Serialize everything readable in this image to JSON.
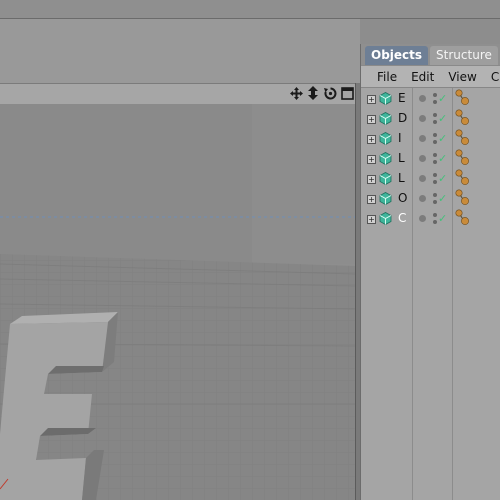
{
  "panel": {
    "tabs": [
      {
        "label": "Objects",
        "active": true
      },
      {
        "label": "Structure",
        "active": false
      }
    ],
    "menu": [
      "File",
      "Edit",
      "View",
      "C"
    ]
  },
  "objects": [
    {
      "name": "E",
      "selected": false
    },
    {
      "name": "D",
      "selected": false
    },
    {
      "name": "I",
      "selected": false
    },
    {
      "name": "L",
      "selected": false
    },
    {
      "name": "L",
      "selected": false
    },
    {
      "name": "O",
      "selected": false
    },
    {
      "name": "C",
      "selected": true
    }
  ],
  "viewport": {
    "icons": [
      "move-icon",
      "zoom-icon",
      "rotate-icon",
      "maximize-icon"
    ],
    "colors": {
      "background": "#8c8c8c",
      "floor": "#868686",
      "letter_front": "#a4a4a4",
      "letter_side": "#7c7c7c",
      "horizon_dashes": "#6f8fb8"
    }
  },
  "colors": {
    "tab_active": "#6e7f95",
    "check": "#44c07a",
    "tag": "#c98b3a"
  }
}
